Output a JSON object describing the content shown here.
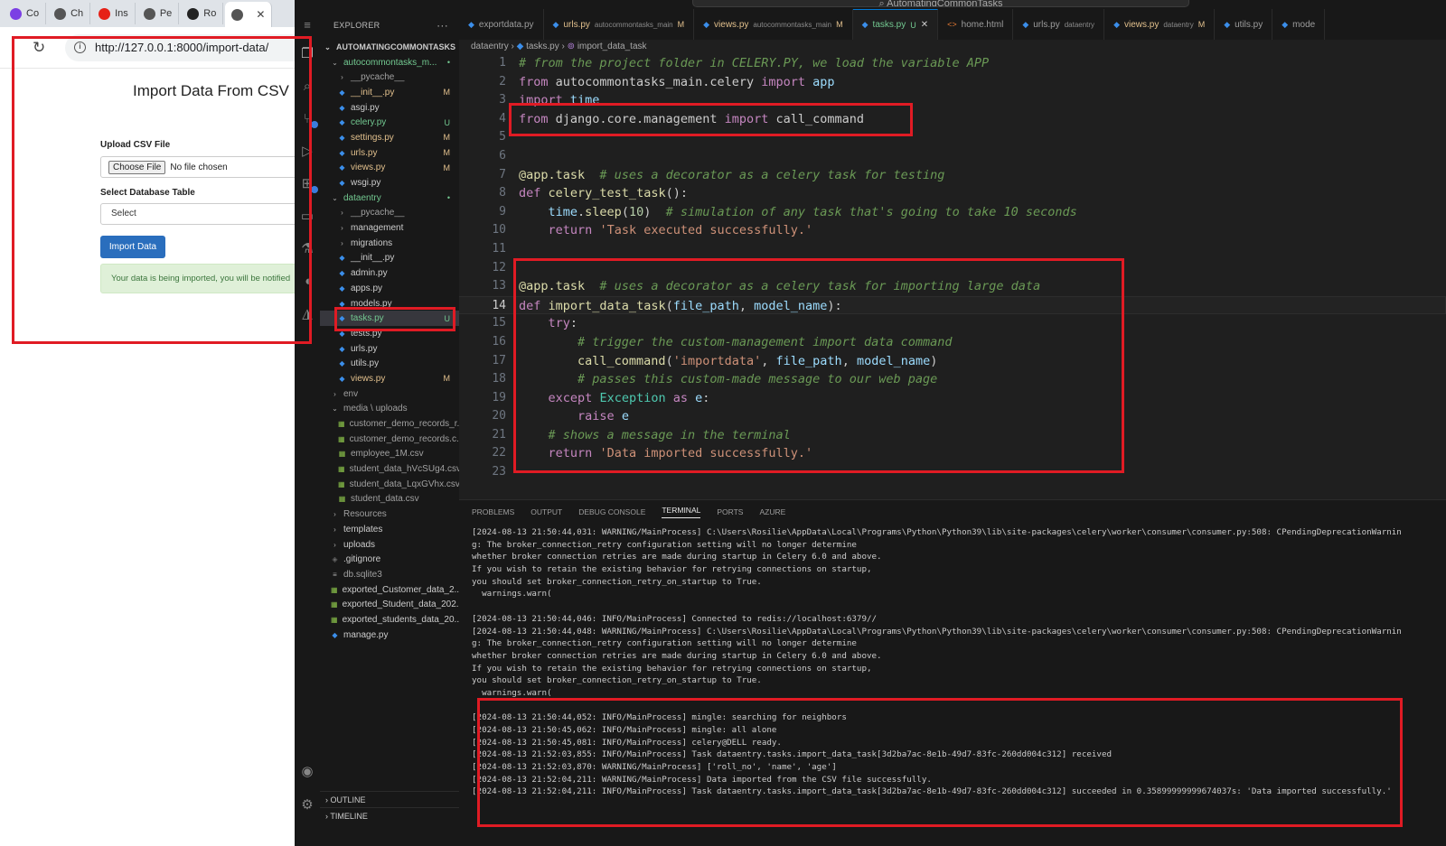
{
  "browser": {
    "tabs": [
      {
        "label": "Co",
        "icon": "purple-circle-icon",
        "color": "#7b3fe4"
      },
      {
        "label": "Ch",
        "icon": "openai-icon",
        "color": "#555555"
      },
      {
        "label": "Ins",
        "icon": "youtube-icon",
        "color": "#e62117"
      },
      {
        "label": "Pe",
        "icon": "globe-icon",
        "color": "#555555"
      },
      {
        "label": "Ro",
        "icon": "github-icon",
        "color": "#222222"
      },
      {
        "label": "",
        "icon": "globe-icon",
        "color": "#555555"
      }
    ],
    "url": "http://127.0.0.1:8000/import-data/",
    "page": {
      "title": "Import Data From CSV",
      "upload_label": "Upload CSV File",
      "choose_file": "Choose File",
      "no_file": "No file chosen",
      "table_label": "Select Database Table",
      "select_placeholder": "Select",
      "import_button": "Import Data",
      "alert": "Your data is being imported, you will be notified"
    }
  },
  "vscode": {
    "title": "AutomatingCommonTasks",
    "explorer": {
      "header": "EXPLORER",
      "root": "AUTOMATINGCOMMONTASKS",
      "items": [
        {
          "name": "autocommontasks_m...",
          "indent": 1,
          "type": "folder-open",
          "status": "•",
          "cls": "nm-new"
        },
        {
          "name": "__pycache__",
          "indent": 2,
          "type": "folder",
          "status": "",
          "cls": "nm-dim"
        },
        {
          "name": "__init__.py",
          "indent": 2,
          "type": "py",
          "status": "M",
          "cls": "nm-mod"
        },
        {
          "name": "asgi.py",
          "indent": 2,
          "type": "py",
          "status": "",
          "cls": ""
        },
        {
          "name": "celery.py",
          "indent": 2,
          "type": "py",
          "status": "U",
          "cls": "nm-new"
        },
        {
          "name": "settings.py",
          "indent": 2,
          "type": "py",
          "status": "M",
          "cls": "nm-mod"
        },
        {
          "name": "urls.py",
          "indent": 2,
          "type": "py",
          "status": "M",
          "cls": "nm-mod"
        },
        {
          "name": "views.py",
          "indent": 2,
          "type": "py",
          "status": "M",
          "cls": "nm-mod"
        },
        {
          "name": "wsgi.py",
          "indent": 2,
          "type": "py",
          "status": "",
          "cls": ""
        },
        {
          "name": "dataentry",
          "indent": 1,
          "type": "folder-open",
          "status": "•",
          "cls": "nm-new"
        },
        {
          "name": "__pycache__",
          "indent": 2,
          "type": "folder",
          "status": "",
          "cls": "nm-dim"
        },
        {
          "name": "management",
          "indent": 2,
          "type": "folder",
          "status": "",
          "cls": ""
        },
        {
          "name": "migrations",
          "indent": 2,
          "type": "folder",
          "status": "",
          "cls": ""
        },
        {
          "name": "__init__.py",
          "indent": 2,
          "type": "py",
          "status": "",
          "cls": ""
        },
        {
          "name": "admin.py",
          "indent": 2,
          "type": "py",
          "status": "",
          "cls": ""
        },
        {
          "name": "apps.py",
          "indent": 2,
          "type": "py",
          "status": "",
          "cls": ""
        },
        {
          "name": "models.py",
          "indent": 2,
          "type": "py",
          "status": "",
          "cls": ""
        },
        {
          "name": "tasks.py",
          "indent": 2,
          "type": "py",
          "status": "U",
          "cls": "nm-new",
          "selected": true
        },
        {
          "name": "tests.py",
          "indent": 2,
          "type": "py",
          "status": "",
          "cls": ""
        },
        {
          "name": "urls.py",
          "indent": 2,
          "type": "py",
          "status": "",
          "cls": ""
        },
        {
          "name": "utils.py",
          "indent": 2,
          "type": "py",
          "status": "",
          "cls": ""
        },
        {
          "name": "views.py",
          "indent": 2,
          "type": "py",
          "status": "M",
          "cls": "nm-mod"
        },
        {
          "name": "env",
          "indent": 1,
          "type": "folder",
          "status": "",
          "cls": "nm-dim"
        },
        {
          "name": "media \\ uploads",
          "indent": 1,
          "type": "folder-open",
          "status": "",
          "cls": "nm-dim"
        },
        {
          "name": "customer_demo_records_r...",
          "indent": 2,
          "type": "csv",
          "status": "",
          "cls": "nm-dim"
        },
        {
          "name": "customer_demo_records.c...",
          "indent": 2,
          "type": "csv",
          "status": "",
          "cls": "nm-dim"
        },
        {
          "name": "employee_1M.csv",
          "indent": 2,
          "type": "csv",
          "status": "",
          "cls": "nm-dim"
        },
        {
          "name": "student_data_hVcSUg4.csv",
          "indent": 2,
          "type": "csv",
          "status": "",
          "cls": "nm-dim"
        },
        {
          "name": "student_data_LqxGVhx.csv",
          "indent": 2,
          "type": "csv",
          "status": "",
          "cls": "nm-dim"
        },
        {
          "name": "student_data.csv",
          "indent": 2,
          "type": "csv",
          "status": "",
          "cls": "nm-dim"
        },
        {
          "name": "Resources",
          "indent": 1,
          "type": "folder",
          "status": "",
          "cls": "nm-dim"
        },
        {
          "name": "templates",
          "indent": 1,
          "type": "folder",
          "status": "",
          "cls": ""
        },
        {
          "name": "uploads",
          "indent": 1,
          "type": "folder",
          "status": "",
          "cls": ""
        },
        {
          "name": ".gitignore",
          "indent": 1,
          "type": "git",
          "status": "",
          "cls": ""
        },
        {
          "name": "db.sqlite3",
          "indent": 1,
          "type": "db",
          "status": "",
          "cls": "nm-dim"
        },
        {
          "name": "exported_Customer_data_2...",
          "indent": 1,
          "type": "csv",
          "status": "",
          "cls": ""
        },
        {
          "name": "exported_Student_data_202...",
          "indent": 1,
          "type": "csv",
          "status": "",
          "cls": ""
        },
        {
          "name": "exported_students_data_20...",
          "indent": 1,
          "type": "csv",
          "status": "",
          "cls": ""
        },
        {
          "name": "manage.py",
          "indent": 1,
          "type": "py",
          "status": "",
          "cls": ""
        }
      ],
      "outline": "OUTLINE",
      "timeline": "TIMELINE"
    },
    "tabs": [
      {
        "label": "exportdata.py",
        "sub": "",
        "badge": "",
        "active": false,
        "cls": ""
      },
      {
        "label": "urls.py",
        "sub": "autocommontasks_main",
        "badge": "M",
        "active": false,
        "cls": "nm-mod"
      },
      {
        "label": "views.py",
        "sub": "autocommontasks_main",
        "badge": "M",
        "active": false,
        "cls": "nm-mod"
      },
      {
        "label": "tasks.py",
        "sub": "",
        "badge": "U",
        "active": true,
        "cls": "nm-new"
      },
      {
        "label": "home.html",
        "sub": "",
        "badge": "",
        "active": false,
        "cls": ""
      },
      {
        "label": "urls.py",
        "sub": "dataentry",
        "badge": "",
        "active": false,
        "cls": ""
      },
      {
        "label": "views.py",
        "sub": "dataentry",
        "badge": "M",
        "active": false,
        "cls": "nm-mod"
      },
      {
        "label": "utils.py",
        "sub": "",
        "badge": "",
        "active": false,
        "cls": ""
      },
      {
        "label": "mode",
        "sub": "",
        "badge": "",
        "active": false,
        "cls": ""
      }
    ],
    "breadcrumb": {
      "folder": "dataentry",
      "file": "tasks.py",
      "symbol": "import_data_task"
    },
    "code": [
      "# from the project folder in CELERY.PY, we load the variable APP",
      "from autocommontasks_main.celery import app",
      "import time",
      "from django.core.management import call_command",
      "",
      "",
      "@app.task  # uses a decorator as a celery task for testing",
      "def celery_test_task():",
      "    time.sleep(10)  # simulation of any task that's going to take 10 seconds",
      "    return 'Task executed successfully.'",
      "",
      "",
      "@app.task  # uses a decorator as a celery task for importing large data",
      "def import_data_task(file_path, model_name):",
      "    try:",
      "        # trigger the custom-management import data command",
      "        call_command('importdata', file_path, model_name)",
      "        # passes this custom-made message to our web page",
      "    except Exception as e:",
      "        raise e",
      "    # shows a message in the terminal",
      "    return 'Data imported successfully.'",
      ""
    ],
    "current_line": 14,
    "panel": {
      "tabs": [
        "PROBLEMS",
        "OUTPUT",
        "DEBUG CONSOLE",
        "TERMINAL",
        "PORTS",
        "AZURE"
      ],
      "active": "TERMINAL",
      "lines": [
        "[2024-08-13 21:50:44,031: WARNING/MainProcess] C:\\Users\\Rosilie\\AppData\\Local\\Programs\\Python\\Python39\\lib\\site-packages\\celery\\worker\\consumer\\consumer.py:508: CPendingDeprecationWarnin",
        "g: The broker_connection_retry configuration setting will no longer determine",
        "whether broker connection retries are made during startup in Celery 6.0 and above.",
        "If you wish to retain the existing behavior for retrying connections on startup,",
        "you should set broker_connection_retry_on_startup to True.",
        "  warnings.warn(",
        "",
        "[2024-08-13 21:50:44,046: INFO/MainProcess] Connected to redis://localhost:6379//",
        "[2024-08-13 21:50:44,048: WARNING/MainProcess] C:\\Users\\Rosilie\\AppData\\Local\\Programs\\Python\\Python39\\lib\\site-packages\\celery\\worker\\consumer\\consumer.py:508: CPendingDeprecationWarnin",
        "g: The broker_connection_retry configuration setting will no longer determine",
        "whether broker connection retries are made during startup in Celery 6.0 and above.",
        "If you wish to retain the existing behavior for retrying connections on startup,",
        "you should set broker_connection_retry_on_startup to True.",
        "  warnings.warn(",
        "",
        "[2024-08-13 21:50:44,052: INFO/MainProcess] mingle: searching for neighbors",
        "[2024-08-13 21:50:45,062: INFO/MainProcess] mingle: all alone",
        "[2024-08-13 21:50:45,081: INFO/MainProcess] celery@DELL ready.",
        "[2024-08-13 21:52:03,855: INFO/MainProcess] Task dataentry.tasks.import_data_task[3d2ba7ac-8e1b-49d7-83fc-260dd004c312] received",
        "[2024-08-13 21:52:03,870: WARNING/MainProcess] ['roll_no', 'name', 'age']",
        "[2024-08-13 21:52:04,211: WARNING/MainProcess] Data imported from the CSV file successfully.",
        "[2024-08-13 21:52:04,211: INFO/MainProcess] Task dataentry.tasks.import_data_task[3d2ba7ac-8e1b-49d7-83fc-260dd004c312] succeeded in 0.35899999999674037s: 'Data imported successfully.'"
      ]
    }
  }
}
